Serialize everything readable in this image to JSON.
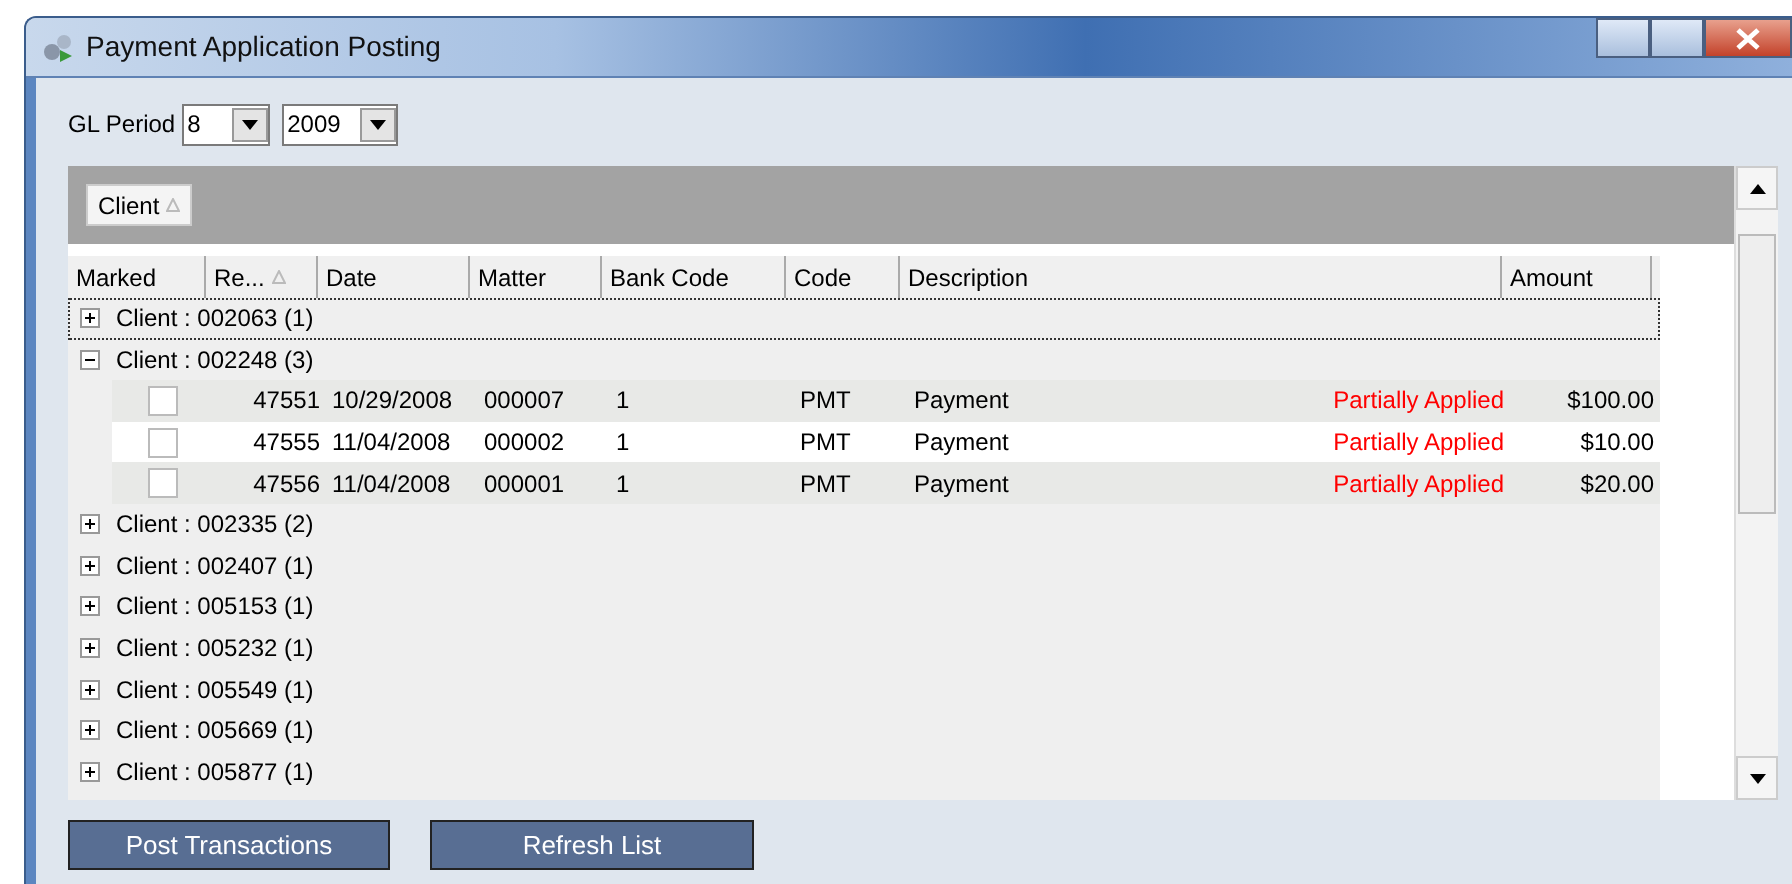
{
  "window": {
    "title": "Payment Application Posting"
  },
  "gl_period": {
    "label": "GL Period",
    "period": "8",
    "year": "2009"
  },
  "group_by": [
    {
      "label": "Client"
    }
  ],
  "columns": [
    {
      "label": "Marked",
      "sorted": false
    },
    {
      "label": "Re...",
      "sorted": true
    },
    {
      "label": "Date",
      "sorted": false
    },
    {
      "label": "Matter",
      "sorted": false
    },
    {
      "label": "Bank Code",
      "sorted": false
    },
    {
      "label": "Code",
      "sorted": false
    },
    {
      "label": "Description",
      "sorted": false
    },
    {
      "label": "Amount",
      "sorted": false
    }
  ],
  "groups": [
    {
      "label": "Client : 002063 (1)",
      "expanded": false,
      "focused": true
    },
    {
      "label": "Client : 002248 (3)",
      "expanded": true,
      "focused": false,
      "rows": [
        {
          "marked": false,
          "reference": "47551",
          "date": "10/29/2008",
          "matter": "000007",
          "bank_code": "1",
          "code": "PMT",
          "description": "Payment",
          "status": "Partially Applied",
          "amount": "$100.00"
        },
        {
          "marked": false,
          "reference": "47555",
          "date": "11/04/2008",
          "matter": "000002",
          "bank_code": "1",
          "code": "PMT",
          "description": "Payment",
          "status": "Partially Applied",
          "amount": "$10.00"
        },
        {
          "marked": false,
          "reference": "47556",
          "date": "11/04/2008",
          "matter": "000001",
          "bank_code": "1",
          "code": "PMT",
          "description": "Payment",
          "status": "Partially Applied",
          "amount": "$20.00"
        }
      ]
    },
    {
      "label": "Client : 002335 (2)",
      "expanded": false,
      "focused": false
    },
    {
      "label": "Client : 002407 (1)",
      "expanded": false,
      "focused": false
    },
    {
      "label": "Client : 005153 (1)",
      "expanded": false,
      "focused": false
    },
    {
      "label": "Client : 005232 (1)",
      "expanded": false,
      "focused": false
    },
    {
      "label": "Client : 005549 (1)",
      "expanded": false,
      "focused": false
    },
    {
      "label": "Client : 005669 (1)",
      "expanded": false,
      "focused": false
    },
    {
      "label": "Client : 005877 (1)",
      "expanded": false,
      "focused": false
    }
  ],
  "buttons": [
    {
      "label": "Post Transactions"
    },
    {
      "label": "Refresh List"
    }
  ]
}
